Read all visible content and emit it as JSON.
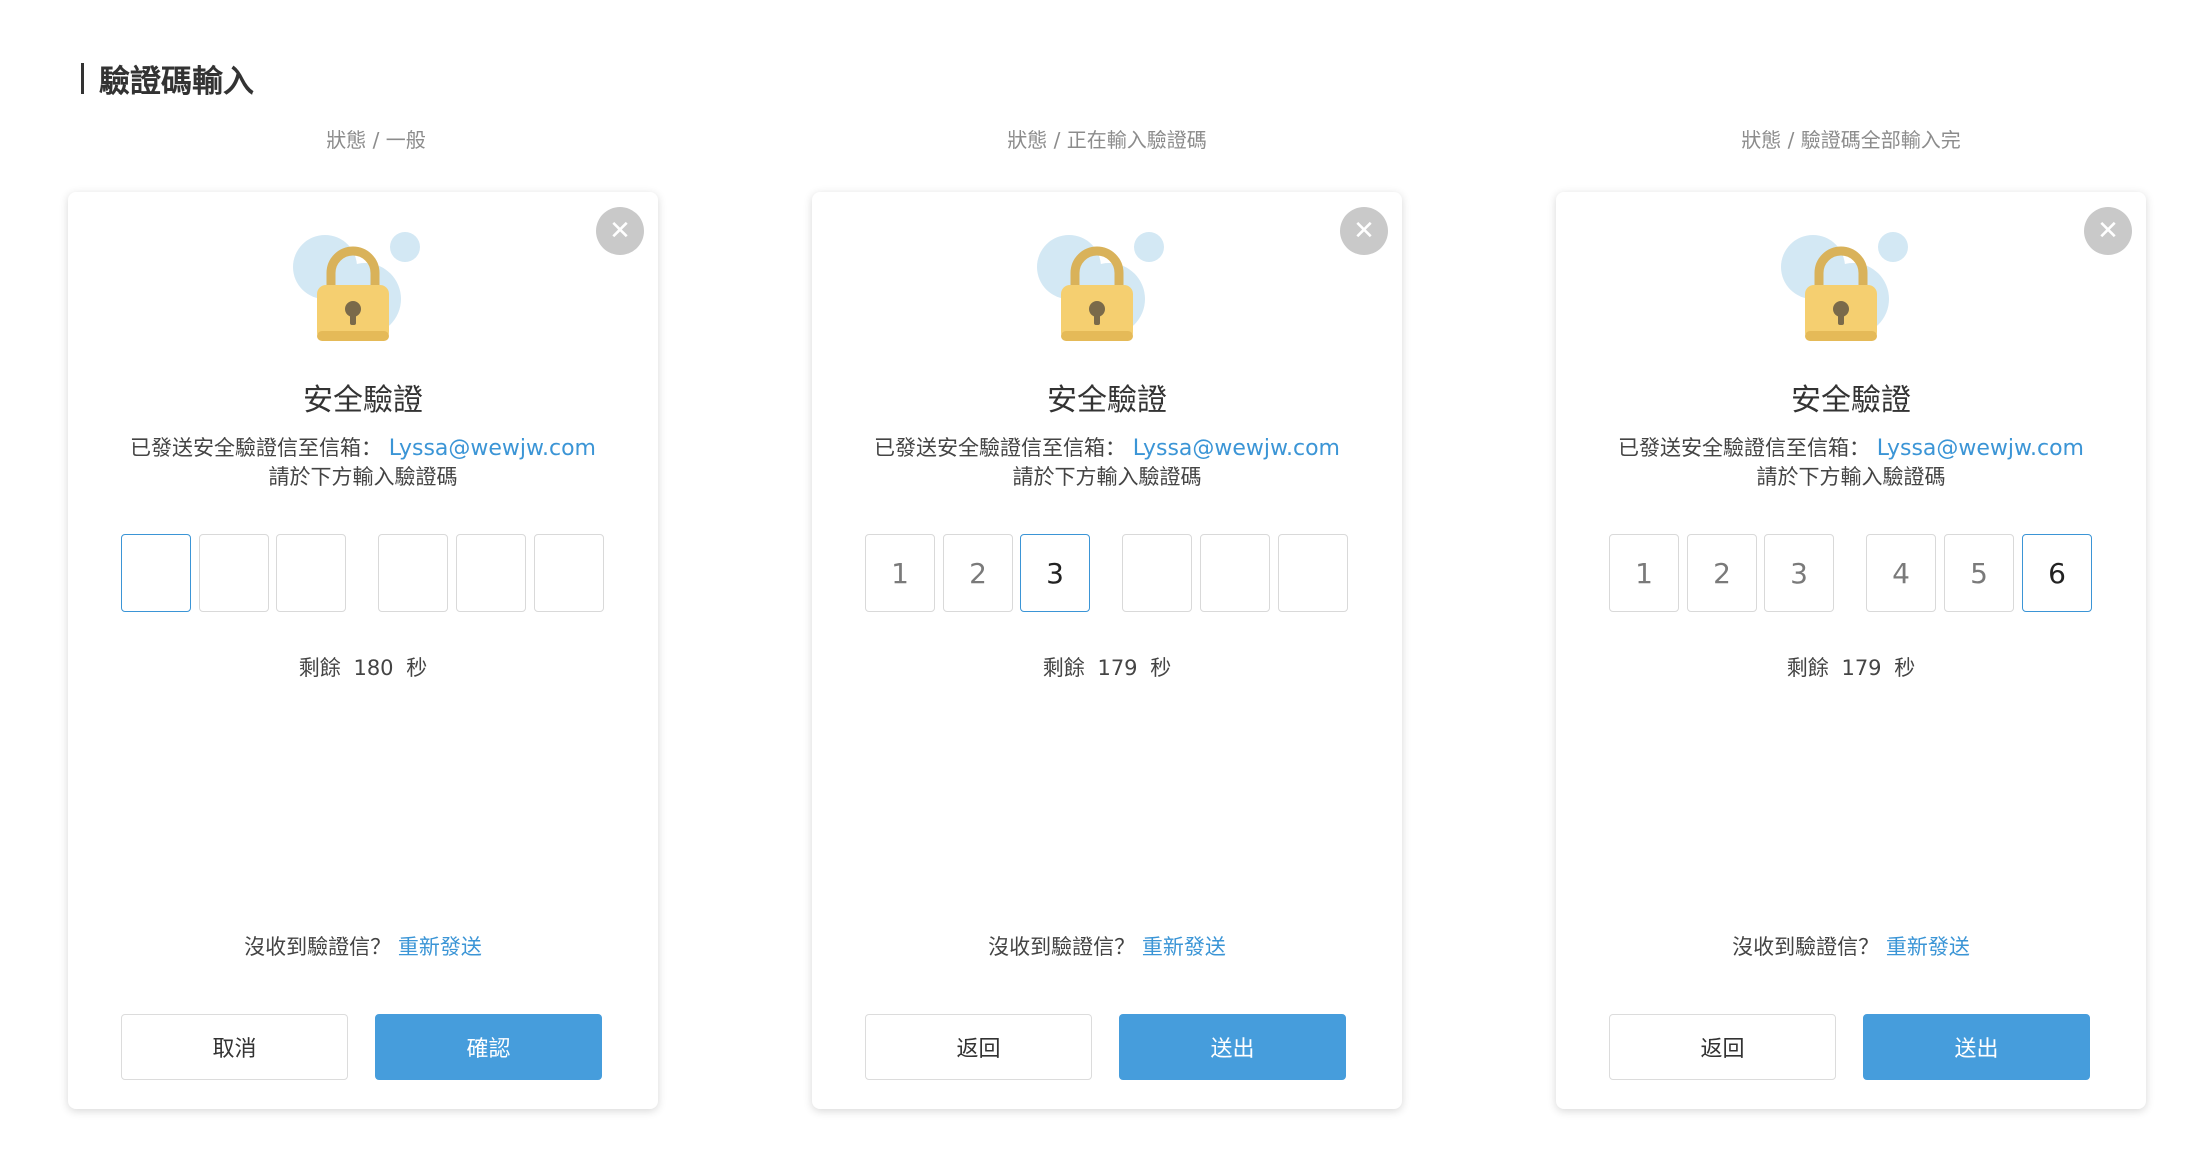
{
  "page": {
    "title": "驗證碼輸入"
  },
  "colors": {
    "accent": "#469ddc",
    "link": "#3b95d6",
    "lock_body": "#f5cf70",
    "lock_shackle": "#d9b25a",
    "bubble": "#d3e8f4"
  },
  "panels": [
    {
      "state_label": "狀態 / 一般",
      "close_icon": "close-icon",
      "title": "安全驗證",
      "info_prefix": "已發送安全驗證信至信箱：",
      "email": "Lyssa@wewjw.com",
      "info_line2": "請於下方輸入驗證碼",
      "digits": [
        "",
        "",
        "",
        "",
        "",
        ""
      ],
      "active_index": 0,
      "timer": "剩餘 180 秒",
      "resend_prompt": "沒收到驗證信？",
      "resend_link": "重新發送",
      "secondary_button": "取消",
      "primary_button": "確認"
    },
    {
      "state_label": "狀態 / 正在輸入驗證碼",
      "close_icon": "close-icon",
      "title": "安全驗證",
      "info_prefix": "已發送安全驗證信至信箱：",
      "email": "Lyssa@wewjw.com",
      "info_line2": "請於下方輸入驗證碼",
      "digits": [
        "1",
        "2",
        "3",
        "",
        "",
        ""
      ],
      "active_index": 2,
      "timer": "剩餘 179 秒",
      "resend_prompt": "沒收到驗證信？",
      "resend_link": "重新發送",
      "secondary_button": "返回",
      "primary_button": "送出"
    },
    {
      "state_label": "狀態 / 驗證碼全部輸入完",
      "close_icon": "close-icon",
      "title": "安全驗證",
      "info_prefix": "已發送安全驗證信至信箱：",
      "email": "Lyssa@wewjw.com",
      "info_line2": "請於下方輸入驗證碼",
      "digits": [
        "1",
        "2",
        "3",
        "4",
        "5",
        "6"
      ],
      "active_index": 5,
      "timer": "剩餘 179 秒",
      "resend_prompt": "沒收到驗證信？",
      "resend_link": "重新發送",
      "secondary_button": "返回",
      "primary_button": "送出"
    }
  ]
}
